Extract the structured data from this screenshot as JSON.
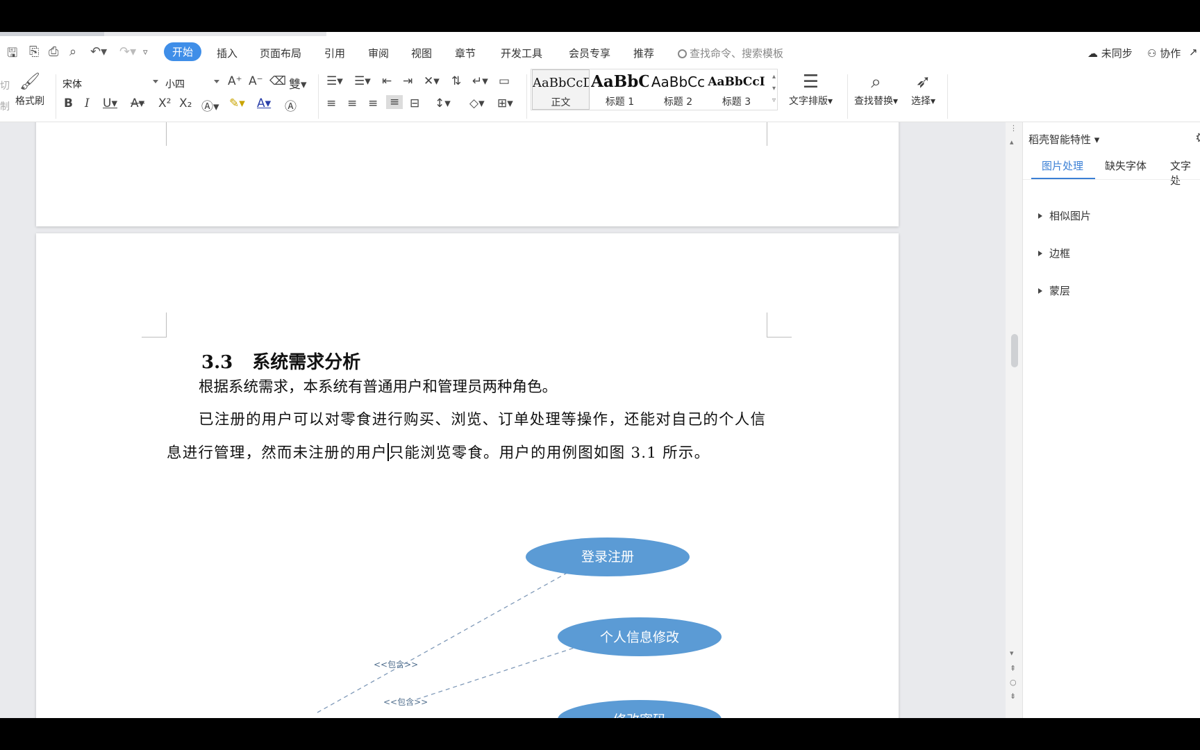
{
  "quick_access": {
    "save_icon": "save-icon",
    "export_icon": "export-icon",
    "print_icon": "print-icon",
    "preview_icon": "print-preview-icon",
    "undo_icon": "undo-icon",
    "redo_icon": "redo-icon",
    "more_icon": "customize-icon"
  },
  "tabs": [
    {
      "label": "开始",
      "active": true
    },
    {
      "label": "插入"
    },
    {
      "label": "页面布局"
    },
    {
      "label": "引用"
    },
    {
      "label": "审阅"
    },
    {
      "label": "视图"
    },
    {
      "label": "章节"
    },
    {
      "label": "开发工具"
    },
    {
      "label": "会员专享"
    },
    {
      "label": "推荐"
    }
  ],
  "search": {
    "placeholder": "查找命令、搜索模板"
  },
  "top_right": {
    "sync": "未同步",
    "collab": "协作"
  },
  "ribbon": {
    "cut": "切",
    "copy": "制",
    "format_painter": "格式刷",
    "font_name": "宋体",
    "font_size": "小四",
    "styles": [
      {
        "sample": "AaBbCcDd",
        "name": "正文"
      },
      {
        "sample": "AaBbC",
        "name": "标题 1"
      },
      {
        "sample": "AaBbCc",
        "name": "标题 2"
      },
      {
        "sample": "AaBbCcI",
        "name": "标题 3"
      }
    ],
    "text_layout": "文字排版",
    "find_replace": "查找替换",
    "select": "选择"
  },
  "document": {
    "heading_num": "3.3",
    "heading_text": "系统需求分析",
    "para1": "根据系统需求，本系统有普通用户和管理员两种角色。",
    "para2_a": "已注册的用户可以对零食进行购买、浏览、订单处理等操作，还能对自己的个人信息进行管理，然而未注册的用户",
    "para2_b": "只能浏览零食。用户的用例图如图 3.1 所示。",
    "diagram": {
      "use_cases": [
        "登录注册",
        "个人信息修改",
        "修改密码"
      ],
      "include_label": "<<包含>>",
      "colors": {
        "use_case_fill": "#5b9bd5",
        "dashed_line": "#7f99b8"
      }
    }
  },
  "right_panel": {
    "title": "稻壳智能特性",
    "tabs": [
      "图片处理",
      "缺失字体",
      "文字处"
    ],
    "items": [
      "相似图片",
      "边框",
      "蒙层"
    ]
  }
}
